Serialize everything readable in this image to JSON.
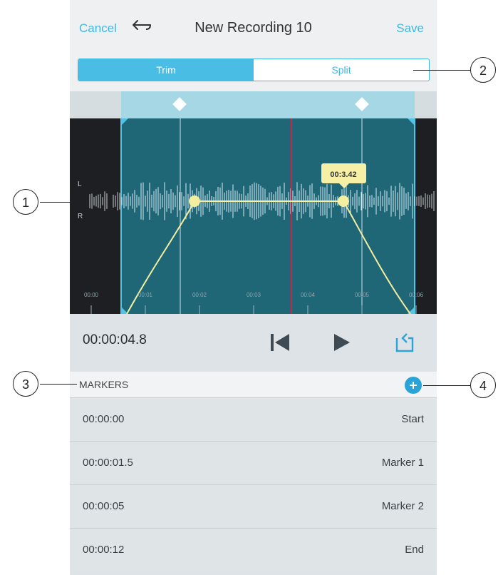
{
  "header": {
    "cancel_label": "Cancel",
    "title": "New Recording 10",
    "save_label": "Save"
  },
  "segment": {
    "trim_label": "Trim",
    "split_label": "Split",
    "selected": "Trim"
  },
  "waveform": {
    "channel_left": "L",
    "channel_right": "R",
    "ticks": [
      "00:00",
      "00:01",
      "00:02",
      "00:03",
      "00:04",
      "00:05",
      "00:06"
    ],
    "tooltip": "00:3.42"
  },
  "transport": {
    "time": "00:00:04.8",
    "icons": [
      "skip-back-icon",
      "play-icon",
      "loop-icon"
    ]
  },
  "markers": {
    "header_label": "MARKERS",
    "add_icon": "plus-icon",
    "items": [
      {
        "time": "00:00:00",
        "name": "Start"
      },
      {
        "time": "00:00:01.5",
        "name": "Marker 1"
      },
      {
        "time": "00:00:05",
        "name": "Marker 2"
      },
      {
        "time": "00:00:12",
        "name": "End"
      }
    ]
  },
  "callouts": [
    "1",
    "2",
    "3",
    "4"
  ],
  "colors": {
    "accent": "#41b8e0",
    "wave_bg": "#1c5c6b",
    "selection": "#2b8aa0",
    "curve": "#f3eea0",
    "playhead": "#c0294a"
  }
}
